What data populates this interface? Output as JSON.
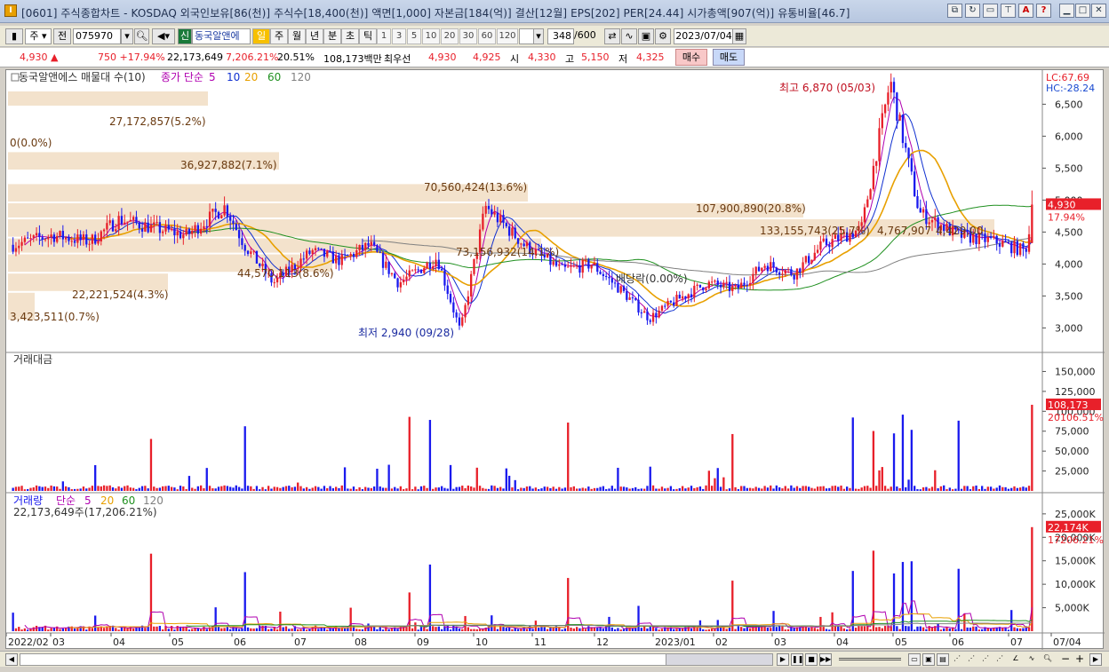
{
  "window": {
    "title": "[0601] 주식종합차트 - KOSDAQ 외국인보유[86(천)] 주식수[18,400(천)] 액면[1,000] 자본금[184(억)] 결산[12월] EPS[202] PER[24.44] 시가총액[907(억)] 유통비율[46.7]",
    "buttons": [
      "min",
      "max",
      "close"
    ]
  },
  "toolbar": {
    "market": "주",
    "jeon": "전",
    "code": "075970",
    "sin": "신",
    "stock_name": "동국알앤에",
    "periods": [
      "일",
      "주",
      "월",
      "년",
      "분",
      "초",
      "틱"
    ],
    "active_period": "일",
    "intervals": [
      "1",
      "3",
      "5",
      "10",
      "20",
      "30",
      "60",
      "120"
    ],
    "count": "348",
    "count_total": "/600",
    "date": "2023/07/04"
  },
  "pricebar": {
    "price": "4,930",
    "change": "750 +17.94%",
    "volume": "22,173,649",
    "vol_ratio": "7,206.21%",
    "turnover": "20.51%",
    "amount": "108,173백만",
    "best_label": "최우선",
    "bid": "4,930",
    "ask": "4,925",
    "open_label": "시",
    "open": "4,330",
    "high_label": "고",
    "high": "5,150",
    "low_label": "저",
    "low": "4,325",
    "buy": "매수",
    "sell": "매도"
  },
  "price_panel": {
    "legend_title": "동국알앤에스 매물대 수(10)",
    "legend_ma": "종가 단순",
    "ma_periods": [
      "5",
      "10",
      "20",
      "60",
      "120"
    ],
    "lc": "LC:67.69",
    "hc": "HC:-28.24",
    "max_label": "최고 6,870 (05/03)",
    "min_label": "최저 2,940 (09/28)",
    "current_price": "4,930",
    "current_pct": "17.94%",
    "y_ticks": [
      "6,500",
      "6,000",
      "5,500",
      "5,000",
      "4,500",
      "4,000",
      "3,500",
      "3,000"
    ],
    "profile_labels": [
      "27,172,857(5.2%)",
      "0(0.0%)",
      "36,927,882(7.1%)",
      "70,560,424(13.6%)",
      "107,900,890(20.8%)",
      "133,155,743(25.7%)",
      "73,156,932(14.1%)",
      "44,570,113(8.6%)",
      "22,221,524(4.3%)",
      "3,423,511(0.7%)"
    ],
    "extra_labels": [
      "배당락(0.00%)",
      "4,767,907",
      "4,429,00"
    ]
  },
  "amount_panel": {
    "legend": "거래대금",
    "y_ticks": [
      "150,000",
      "125,000",
      "100,000",
      "75,000",
      "50,000",
      "25,000"
    ],
    "current": "108,173",
    "current_sub": "20106.51%"
  },
  "volume_panel": {
    "legend_title": "거래량",
    "legend_ma": "단순",
    "ma_periods": [
      "5",
      "20",
      "60",
      "120"
    ],
    "sub": "22,173,649주(17,206.21%)",
    "y_ticks": [
      "25,000K",
      "20,000K",
      "15,000K",
      "10,000K",
      "5,000K"
    ],
    "current": "22,174K",
    "current_sub": "17206.21%"
  },
  "x_axis": [
    "2022/02",
    "03",
    "04",
    "05",
    "06",
    "07",
    "08",
    "09",
    "10",
    "11",
    "12",
    "2023/01",
    "02",
    "03",
    "04",
    "05",
    "06",
    "07",
    "07/04"
  ],
  "colors": {
    "up": "#e8202a",
    "down": "#1a1aee",
    "ma5": "#b000b0",
    "ma10": "#1030d0",
    "ma20": "#e8a000",
    "ma60": "#209020",
    "ma120": "#808080",
    "profile": "#f3e2cc"
  }
}
